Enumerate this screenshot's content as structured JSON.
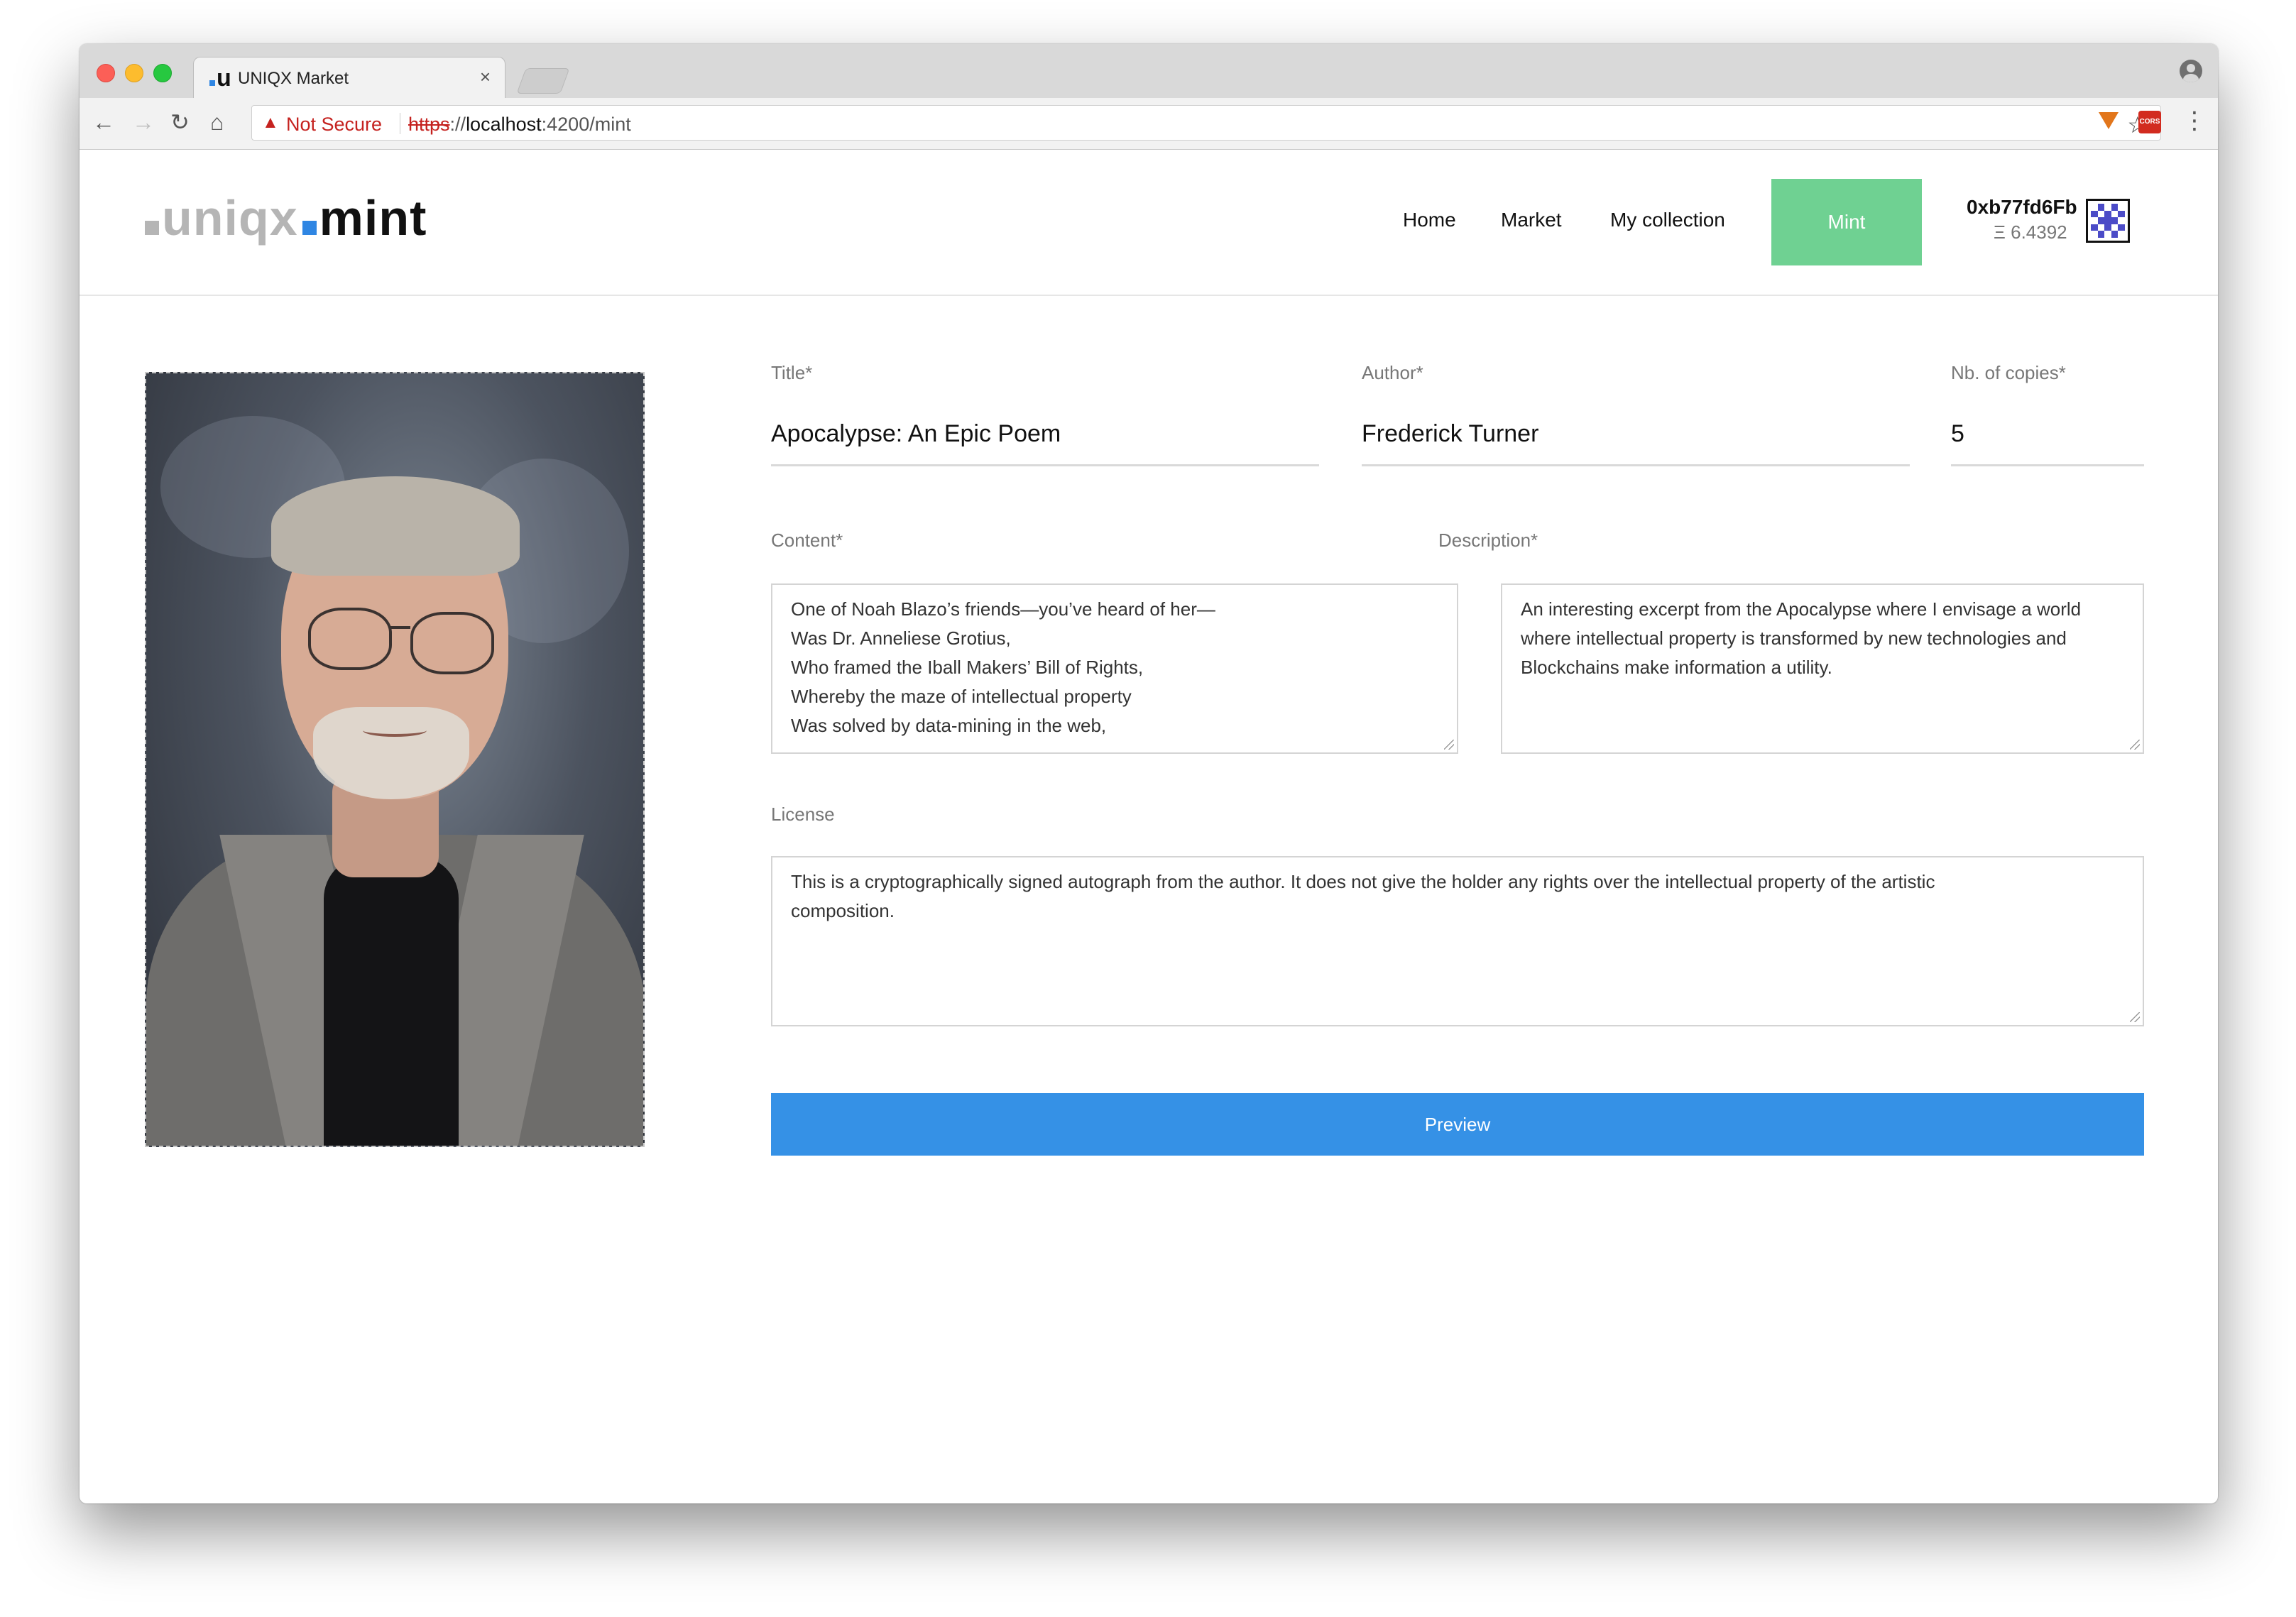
{
  "browser": {
    "tab_title": "UNIQX Market",
    "tab_favicon": "u",
    "tab_close": "×",
    "security_label": "Not Secure",
    "url_scheme": "https",
    "url_sep": "://",
    "url_host": "localhost",
    "url_path": ":4200/mint",
    "icons": [
      "back-arrow-icon",
      "forward-arrow-icon",
      "reload-icon",
      "home-icon",
      "warning-icon",
      "star-icon",
      "metamask-fox-icon",
      "cors-extension-icon",
      "kebab-menu-icon",
      "profile-icon"
    ],
    "cors_icon_text": "CORS"
  },
  "header": {
    "logo_prefix": "uniqx",
    "logo_suffix": "mint",
    "nav": {
      "home": "Home",
      "market": "Market",
      "collection": "My collection",
      "mint": "Mint"
    },
    "account": {
      "address": "0xb77fd6Fb",
      "balance": "Ξ 6.4392"
    },
    "mint_color": "#6fd192"
  },
  "form": {
    "title_label": "Title*",
    "title_value": "Apocalypse: An Epic Poem",
    "author_label": "Author*",
    "author_value": "Frederick Turner",
    "copies_label": "Nb. of copies*",
    "copies_value": "5",
    "content_label": "Content*",
    "content_lines": [
      "One of Noah Blazo’s friends—you’ve heard of her—",
      "Was Dr. Anneliese Grotius,",
      "Who framed the Iball Makers’ Bill of Rights,",
      "Whereby the maze of intellectual property",
      "Was solved by data-mining in the web,"
    ],
    "description_label": "Description*",
    "description_lines": [
      "An interesting excerpt from the Apocalypse where I envisage a world",
      "where intellectual property is transformed by new technologies and",
      "Blockchains make information a utility."
    ],
    "license_label": "License",
    "license_lines": [
      "This is a cryptographically signed autograph from the author. It does not give the holder any rights over the intellectual property of the artistic",
      "composition."
    ],
    "preview_label": "Preview",
    "preview_color": "#3591e6"
  }
}
